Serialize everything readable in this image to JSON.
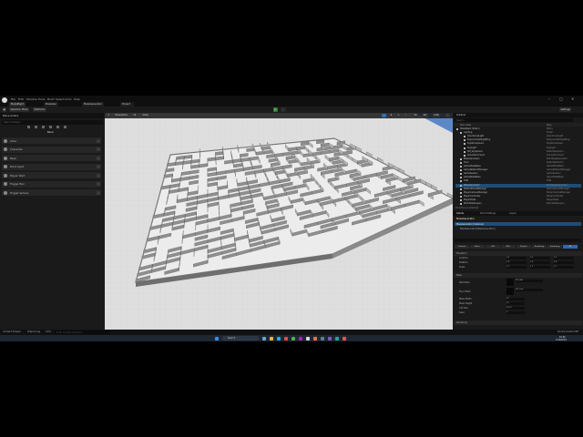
{
  "app": {
    "title": "MazeMap3",
    "menu": [
      "File",
      "Edit",
      "Window",
      "Tools",
      "Build",
      "Select",
      "Actor",
      "Help"
    ],
    "tabs": [
      "MazeMap3",
      "MazeGen",
      "MazeGenerator",
      "Project Settings"
    ],
    "window_controls": {
      "minimize": "–",
      "maximize": "□",
      "close": "✕"
    }
  },
  "toolbar": {
    "select_mode": "Selection Mode",
    "platforms": "Platforms",
    "settings": "Settings"
  },
  "left_panel": {
    "title": "Place Actors",
    "search_placeholder": "Search Classes",
    "category": "Basic",
    "items": [
      {
        "label": "Actor",
        "icon": "actor-icon"
      },
      {
        "label": "Character",
        "icon": "character-icon"
      },
      {
        "label": "Pawn",
        "icon": "pawn-icon"
      },
      {
        "label": "Point Light",
        "icon": "point-light-icon"
      },
      {
        "label": "Player Start",
        "icon": "player-start-icon"
      },
      {
        "label": "Trigger Box",
        "icon": "trigger-box-icon"
      },
      {
        "label": "Trigger Sphere",
        "icon": "trigger-sphere-icon"
      }
    ]
  },
  "viewport": {
    "perspective": "Perspective",
    "view_mode": "Lit",
    "show": "Show",
    "scale": "0.25",
    "grid_size": "10",
    "rotation": "10°"
  },
  "outliner": {
    "title": "Outliner",
    "search_placeholder": "Search...",
    "col_label": "Item Label",
    "col_type": "Type",
    "rows": [
      {
        "label": "MazeMap3 (Editor)",
        "type": "World",
        "selected": false,
        "indent": 0
      },
      {
        "label": "Lighting",
        "type": "Folder",
        "selected": false,
        "indent": 1
      },
      {
        "label": "DirectionalLight",
        "type": "DirectionalLight",
        "selected": false,
        "indent": 2
      },
      {
        "label": "ExponentialHeightFog",
        "type": "ExponentialHeightFog",
        "selected": false,
        "indent": 2
      },
      {
        "label": "SkyAtmosphere",
        "type": "SkyAtmosphere",
        "selected": false,
        "indent": 2
      },
      {
        "label": "SkyLight",
        "type": "SkyLight",
        "selected": false,
        "indent": 2
      },
      {
        "label": "SM_SkySphere",
        "type": "StaticMeshActor",
        "selected": false,
        "indent": 2
      },
      {
        "label": "VolumetricCloud",
        "type": "VolumetricCloud",
        "selected": false,
        "indent": 2
      },
      {
        "label": "MazeGenerator",
        "type": "Edit MazeGenerator",
        "selected": false,
        "indent": 1
      },
      {
        "label": "Floor",
        "type": "StaticMeshActor",
        "selected": false,
        "indent": 1
      },
      {
        "label": "GameModeBase",
        "type": "GameModeBase",
        "selected": false,
        "indent": 1
      },
      {
        "label": "GameNetworkManager",
        "type": "GameNetworkManager",
        "selected": false,
        "indent": 1
      },
      {
        "label": "GameSession",
        "type": "GameSession",
        "selected": false,
        "indent": 1
      },
      {
        "label": "GameStateBase",
        "type": "GameStateBase",
        "selected": false,
        "indent": 1
      },
      {
        "label": "HUD",
        "type": "HUD",
        "selected": false,
        "indent": 1
      },
      {
        "label": "MazeGenerator",
        "type": "Edit MazeGenerator",
        "selected": true,
        "indent": 1
      },
      {
        "label": "ParticleEventManager",
        "type": "ParticleEventManager",
        "selected": false,
        "indent": 1
      },
      {
        "label": "PlayerCameraManager",
        "type": "PlayerCameraManager",
        "selected": false,
        "indent": 1
      },
      {
        "label": "PlayerController",
        "type": "PlayerController",
        "selected": false,
        "indent": 1
      },
      {
        "label": "PlayerState",
        "type": "PlayerState",
        "selected": false,
        "indent": 1
      },
      {
        "label": "WorldDataLayers",
        "type": "WorldDataLayers",
        "selected": false,
        "indent": 1
      }
    ],
    "footer": "24 actors (1 selected)"
  },
  "details": {
    "tabs": [
      "Details",
      "World Settings",
      "Layers"
    ],
    "actor": "MazeGenerator",
    "component": "MazeGenerator (Instance)",
    "class": "MazeGenerator(MazeGenerator1)",
    "filter_tabs": [
      "General",
      "Actor",
      "LOD",
      "Misc",
      "Physics",
      "Rendering",
      "Streaming",
      "All"
    ],
    "section_transform": "Transform",
    "location": "Location",
    "rotation": "Rotation",
    "scale": "Scale",
    "loc": [
      "0.0",
      "0.0",
      "0.0"
    ],
    "rot": [
      "0.0°",
      "0.0°",
      "0.0°"
    ],
    "scl": [
      "1.0",
      "1.0",
      "1.0"
    ],
    "section_maze": "Maze",
    "wall_mesh": "Wall Mesh",
    "wall_mesh_value": "SM_Wall",
    "floor_mesh": "Floor Mesh",
    "floor_mesh_value": "SM_Floor",
    "maze_width": "Maze Width",
    "maze_width_value": "30",
    "maze_height": "Maze Height",
    "maze_height_value": "30",
    "cell_size": "Cell Size",
    "cell_size_value": "100.0",
    "seed": "Seed",
    "seed_value": "0",
    "section_rendering": "Rendering"
  },
  "status_bar": {
    "content_drawer": "Content Drawer",
    "output_log": "Output Log",
    "cmd": "Cmd",
    "cmd_placeholder": "Enter Console Command",
    "source_control": "Source Control Off"
  },
  "taskbar": {
    "search": "Search",
    "time": "10:26",
    "date": "1/14/2024"
  },
  "colors": {
    "accent": "#2a6ab3",
    "selection": "#1e4e78",
    "maze_wall": "#9b9b9b",
    "maze_floor": "#e8e8e8"
  }
}
